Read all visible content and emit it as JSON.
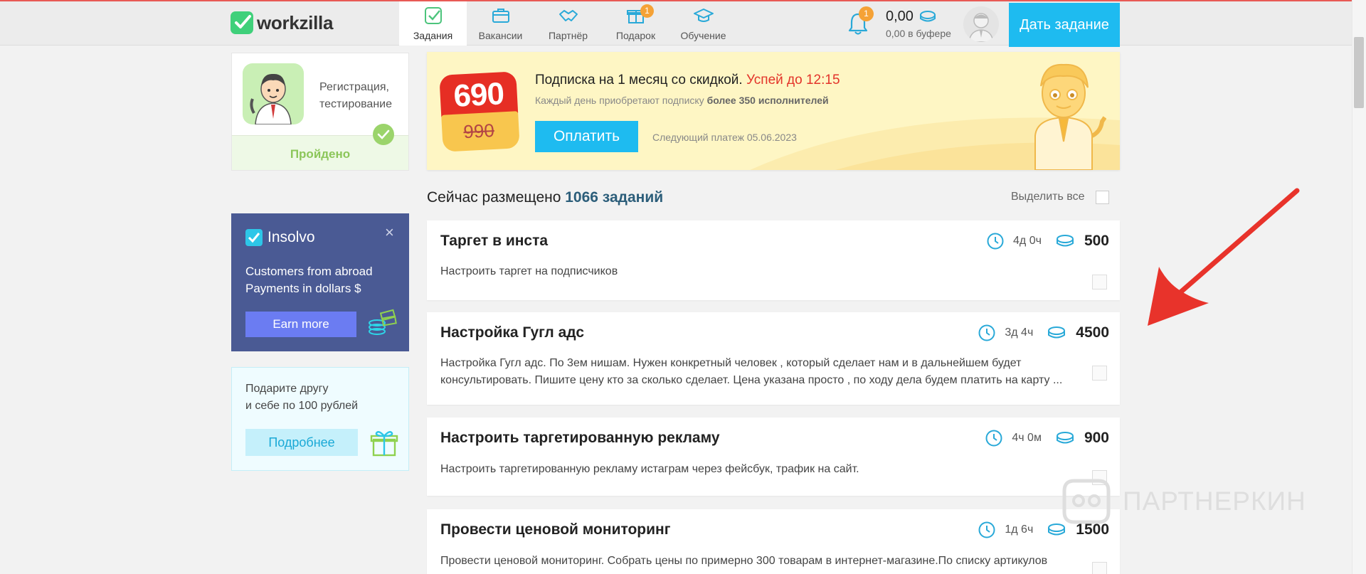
{
  "header": {
    "logo": "workzilla",
    "nav": [
      {
        "label": "Задания",
        "active": true
      },
      {
        "label": "Вакансии"
      },
      {
        "label": "Партнёр"
      },
      {
        "label": "Подарок",
        "badge": "1"
      },
      {
        "label": "Обучение"
      }
    ],
    "notifications_badge": "1",
    "balance": "0,00",
    "balance_buffer": "0,00 в буфере",
    "give_task": "Дать задание"
  },
  "sidebar": {
    "registration": {
      "line1": "Регистрация,",
      "line2": "тестирование",
      "status": "Пройдено"
    },
    "insolvo": {
      "logo": "Insolvo",
      "close": "×",
      "line1": "Customers from abroad",
      "line2": "Payments in dollars $",
      "button": "Earn more"
    },
    "gift": {
      "line1": "Подарите другу",
      "line2": "и себе по 100 рублей",
      "button": "Подробнее"
    }
  },
  "promo": {
    "price_new": "690",
    "price_old": "990",
    "title": "Подписка на 1 месяц со скидкой.",
    "title_hot": "Успей до 12:15",
    "subtitle_pre": "Каждый день приобретают подписку",
    "subtitle_bold": "более 350 исполнителей",
    "pay_button": "Оплатить",
    "next_payment": "Следующий платеж 05.06.2023"
  },
  "tasks_header": {
    "prefix": "Сейчас размещено",
    "count": "1066 заданий",
    "select_all": "Выделить все"
  },
  "tasks": [
    {
      "title": "Таргет в инста",
      "time": "4д 0ч",
      "price": "500",
      "desc": "Настроить таргет на подписчиков"
    },
    {
      "title": "Настройка Гугл адс",
      "time": "3д 4ч",
      "price": "4500",
      "desc": "Настройка Гугл адс. По 3ем нишам. Нужен конкретный человек , который сделает нам и в дальнейшем будет консультировать. Пишите цену кто за сколько сделает. Цена указана просто , по ходу дела будем платить на карту ..."
    },
    {
      "title": "Настроить таргетированную рекламу",
      "time": "4ч 0м",
      "price": "900",
      "desc": "Настроить таргетированную рекламу истаграм через фейсбук, трафик на сайт."
    },
    {
      "title": "Провести ценовой мониторинг",
      "time": "1д 6ч",
      "price": "1500",
      "desc": "Провести ценовой мониторинг. Собрать цены по примерно 300 товарам в интернет-магазине.По списку артикулов"
    }
  ],
  "watermark": "ПАРТНЕРКИН",
  "colors": {
    "accent": "#1ebbf0",
    "green": "#3fd07a",
    "badge": "#f5a236",
    "insolvo": "#4a5a94",
    "arrow": "#e8332b"
  }
}
